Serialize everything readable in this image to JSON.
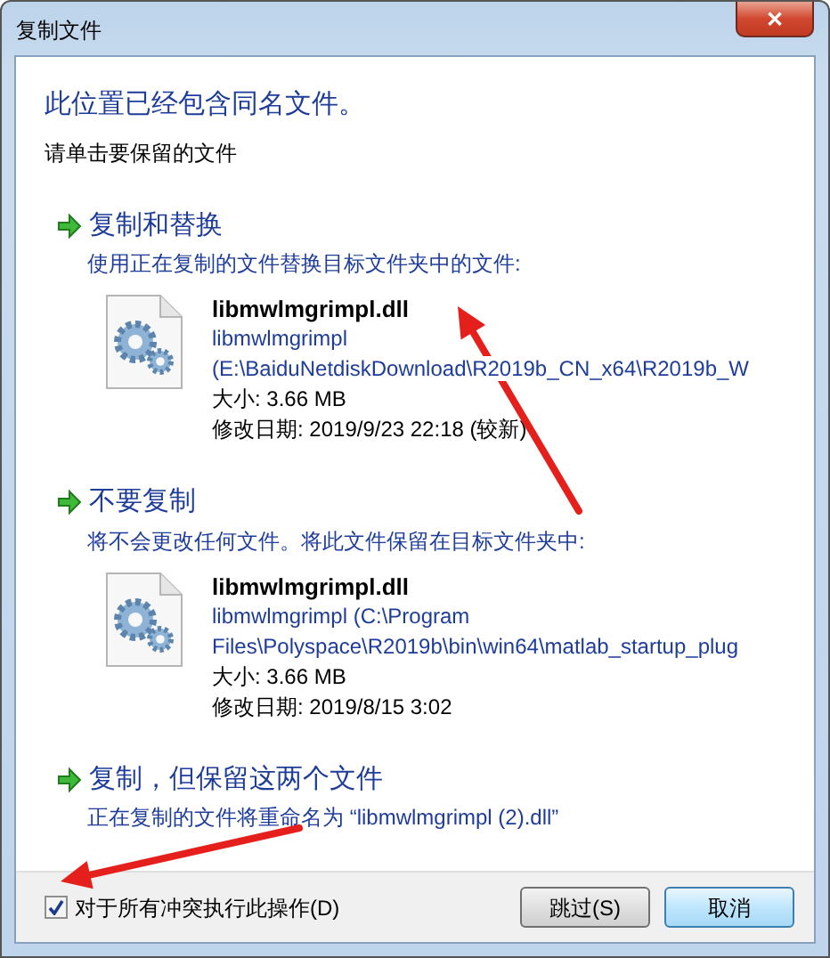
{
  "window": {
    "title": "复制文件",
    "close": "✕"
  },
  "heading": "此位置已经包含同名文件。",
  "instruction": "请单击要保留的文件",
  "options": [
    {
      "title": "复制和替换",
      "description": "使用正在复制的文件替换目标文件夹中的文件:",
      "file": {
        "name": "libmwlmgrimpl.dll",
        "location": [
          "libmwlmgrimpl",
          "(E:\\BaiduNetdiskDownload\\R2019b_CN_x64\\R2019b_W"
        ],
        "size": "大小: 3.66 MB",
        "modified": "修改日期: 2019/9/23 22:18 (较新)"
      }
    },
    {
      "title": "不要复制",
      "description": "将不会更改任何文件。将此文件保留在目标文件夹中:",
      "file": {
        "name": "libmwlmgrimpl.dll",
        "location": [
          "libmwlmgrimpl (C:\\Program",
          "Files\\Polyspace\\R2019b\\bin\\win64\\matlab_startup_plug"
        ],
        "size": "大小: 3.66 MB",
        "modified": "修改日期: 2019/8/15 3:02"
      }
    },
    {
      "title": "复制，但保留这两个文件",
      "description": "正在复制的文件将重命名为 “libmwlmgrimpl (2).dll”"
    }
  ],
  "footer": {
    "checkbox": {
      "label": "对于所有冲突执行此操作(D)",
      "checked": true
    },
    "buttons": [
      {
        "label": "跳过(S)",
        "kind": "normal"
      },
      {
        "label": "取消",
        "kind": "default"
      }
    ]
  },
  "annotations": [
    {
      "kind": "arrow"
    },
    {
      "kind": "arrow"
    }
  ]
}
